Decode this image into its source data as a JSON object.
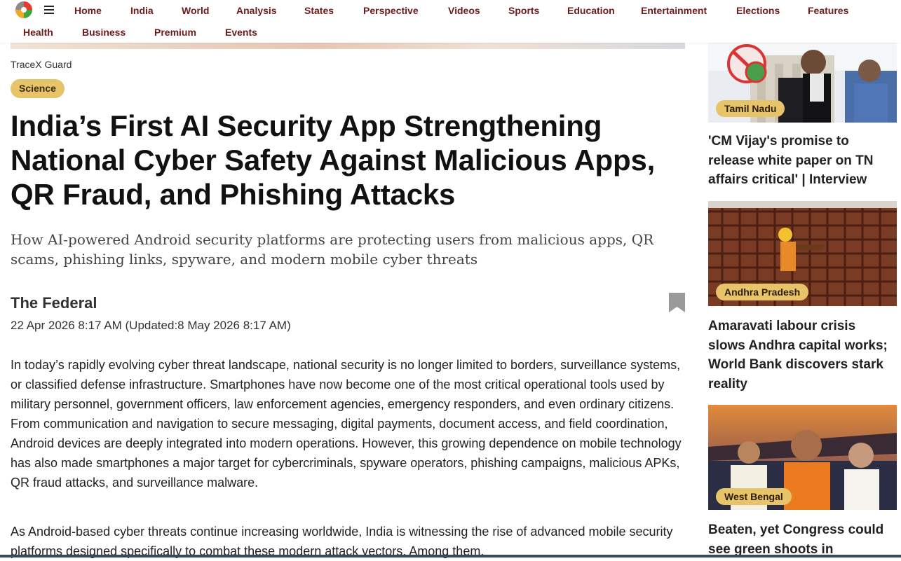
{
  "nav": {
    "row1": [
      "Home",
      "India",
      "World",
      "Analysis",
      "States",
      "Perspective",
      "Videos",
      "Sports",
      "Education",
      "Entertainment",
      "Elections",
      "Features"
    ],
    "row2": [
      "Health",
      "Business",
      "Premium",
      "Events"
    ],
    "logo_icon": "the-federal-logo",
    "menu_icon": "hamburger-menu-icon"
  },
  "article": {
    "image_credit": "TraceX Guard",
    "category": "Science",
    "headline": "India’s First AI Security App Strengthening National Cyber Safety Against Malicious Apps, QR Fraud, and Phishing Attacks",
    "subheadline": "How AI-powered Android security platforms are protecting users from malicious apps, QR scams, phishing links, spyware, and modern mobile cyber threats",
    "author": "The Federal",
    "date": "22 Apr 2026 8:17 AM  (Updated:8 May 2026 8:17 AM)",
    "bookmark_icon": "bookmark-icon",
    "paragraphs": [
      "In today’s rapidly evolving cyber threat landscape, national security is no longer limited to borders, surveillance systems, or classified defense infrastructure. Smartphones have now become one of the most critical operational tools used by military personnel, government officers, law enforcement agencies, emergency responders, and even ordinary citizens. From communication and navigation to secure messaging, digital payments, document access, and field coordination, Android devices are deeply integrated into modern operations. However, this growing dependence on mobile technology has also made smartphones a major target for cybercriminals, spyware operators, phishing campaigns, malicious APKs, QR fraud attacks, and surveillance malware.",
      "As Android-based cyber threats continue increasing worldwide, India is witnessing the rise of advanced mobile security platforms designed specifically to combat these modern attack vectors. Among them,"
    ]
  },
  "sidebar": {
    "cards": [
      {
        "tag": "Tamil Nadu",
        "title": "'CM Vijay's promise to release white paper on TN affairs critical' | Interview"
      },
      {
        "tag": "Andhra Pradesh",
        "title": "Amaravati labour crisis slows Andhra capital works; World Bank discovers stark reality"
      },
      {
        "tag": "West Bengal",
        "title": "Beaten, yet Congress could see green shoots in"
      }
    ]
  },
  "colors": {
    "nav_text": "#6e1a1a",
    "tag_bg": "#e7c46a",
    "headline": "#111111"
  }
}
